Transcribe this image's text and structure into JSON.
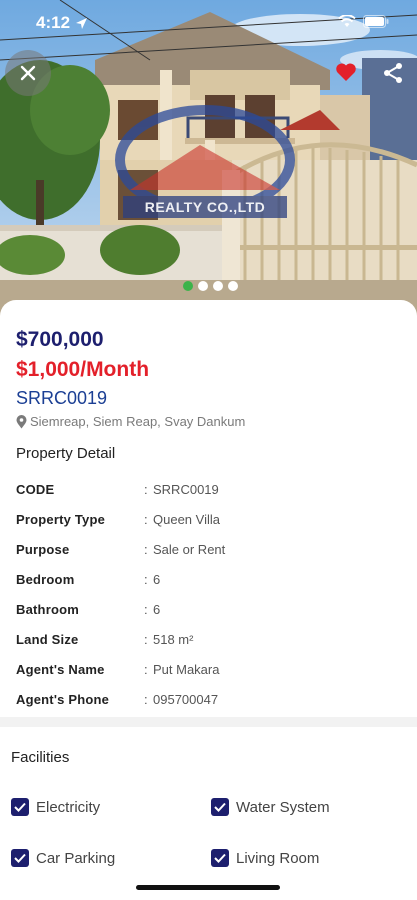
{
  "status_bar": {
    "time": "4:12"
  },
  "hero": {
    "watermark": "REALTY CO.,LTD",
    "slide_count": 4,
    "active_slide": 1
  },
  "listing": {
    "price": "$700,000",
    "rent": "$1,000/Month",
    "code": "SRRC0019",
    "location": "Siemreap, Siem Reap, Svay Dankum"
  },
  "property_detail": {
    "title": "Property Detail",
    "rows": [
      {
        "label": "CODE",
        "value": "SRRC0019"
      },
      {
        "label": "Property Type",
        "value": "Queen Villa"
      },
      {
        "label": "Purpose",
        "value": "Sale or Rent"
      },
      {
        "label": "Bedroom",
        "value": "6"
      },
      {
        "label": "Bathroom",
        "value": "6"
      },
      {
        "label": "Land Size",
        "value": "518 m²"
      },
      {
        "label": "Agent's Name",
        "value": "Put Makara"
      },
      {
        "label": "Agent's Phone",
        "value": "095700047"
      }
    ]
  },
  "facilities": {
    "title": "Facilities",
    "items": [
      {
        "label": "Electricity",
        "checked": true
      },
      {
        "label": "Water System",
        "checked": true
      },
      {
        "label": "Car Parking",
        "checked": true
      },
      {
        "label": "Living Room",
        "checked": true
      }
    ]
  },
  "colors": {
    "price": "#1d1f6e",
    "rent": "#e3202a",
    "code": "#1b3f94",
    "favorite": "#e3202a",
    "active_dot": "#3cb34a",
    "checkbox": "#1d1f6e"
  },
  "icons": {
    "close": "close-icon",
    "favorite": "heart-icon",
    "share": "share-icon",
    "location": "location-pin-icon",
    "checkbox": "checkbox-checked-icon"
  }
}
